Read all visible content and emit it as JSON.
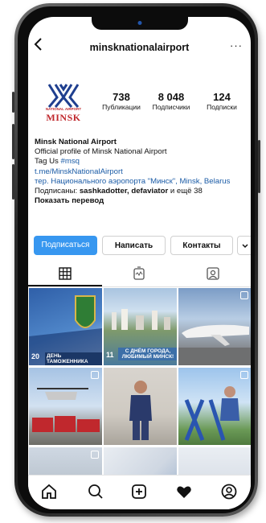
{
  "header": {
    "back_icon": "back-arrow-icon",
    "username": "minsknationalairport",
    "more_icon": "more-icon"
  },
  "logo": {
    "line1": "NATIONAL AIRPORT",
    "line2": "MINSK"
  },
  "stats": [
    {
      "value": "738",
      "label": "Публикации"
    },
    {
      "value": "8 048",
      "label": "Подписчики"
    },
    {
      "value": "124",
      "label": "Подписки"
    }
  ],
  "bio": {
    "name": "Minsk National Airport",
    "line1": "Official profile of Minsk National Airport",
    "tag_prefix": "Tag Us ",
    "tag": "#msq",
    "link": "t.me/MinskNationalAirport",
    "location": "тер. Национального аэропорта \"Минск\", Minsk, Belarus",
    "followed_prefix": "Подписаны: ",
    "followed_names": "sashkadotter, defaviator",
    "followed_suffix": " и ещё 38",
    "translate": "Показать перевод"
  },
  "actions": {
    "follow": "Подписаться",
    "message": "Написать",
    "contacts": "Контакты",
    "chevron": "⌄"
  },
  "tabs": [
    {
      "icon": "grid-icon",
      "active": true
    },
    {
      "icon": "reels-icon",
      "active": false
    },
    {
      "icon": "tagged-icon",
      "active": false
    }
  ],
  "posts": [
    {
      "caption": "ДЕНЬ ТАМОЖЕННИКА",
      "badge": "20"
    },
    {
      "caption": "С ДНЁМ ГОРОДА, ЛЮБИМЫЙ МИНСК!",
      "badge": "11"
    },
    {
      "caption": ""
    },
    {
      "caption": ""
    },
    {
      "caption": ""
    },
    {
      "caption": ""
    }
  ],
  "colors": {
    "accent": "#3797f0",
    "link": "#1a5ba6",
    "logo_blue": "#1f3f8f",
    "logo_red": "#c0282d"
  },
  "nav": [
    "home-icon",
    "search-icon",
    "new-post-icon",
    "activity-heart-icon",
    "profile-icon"
  ]
}
